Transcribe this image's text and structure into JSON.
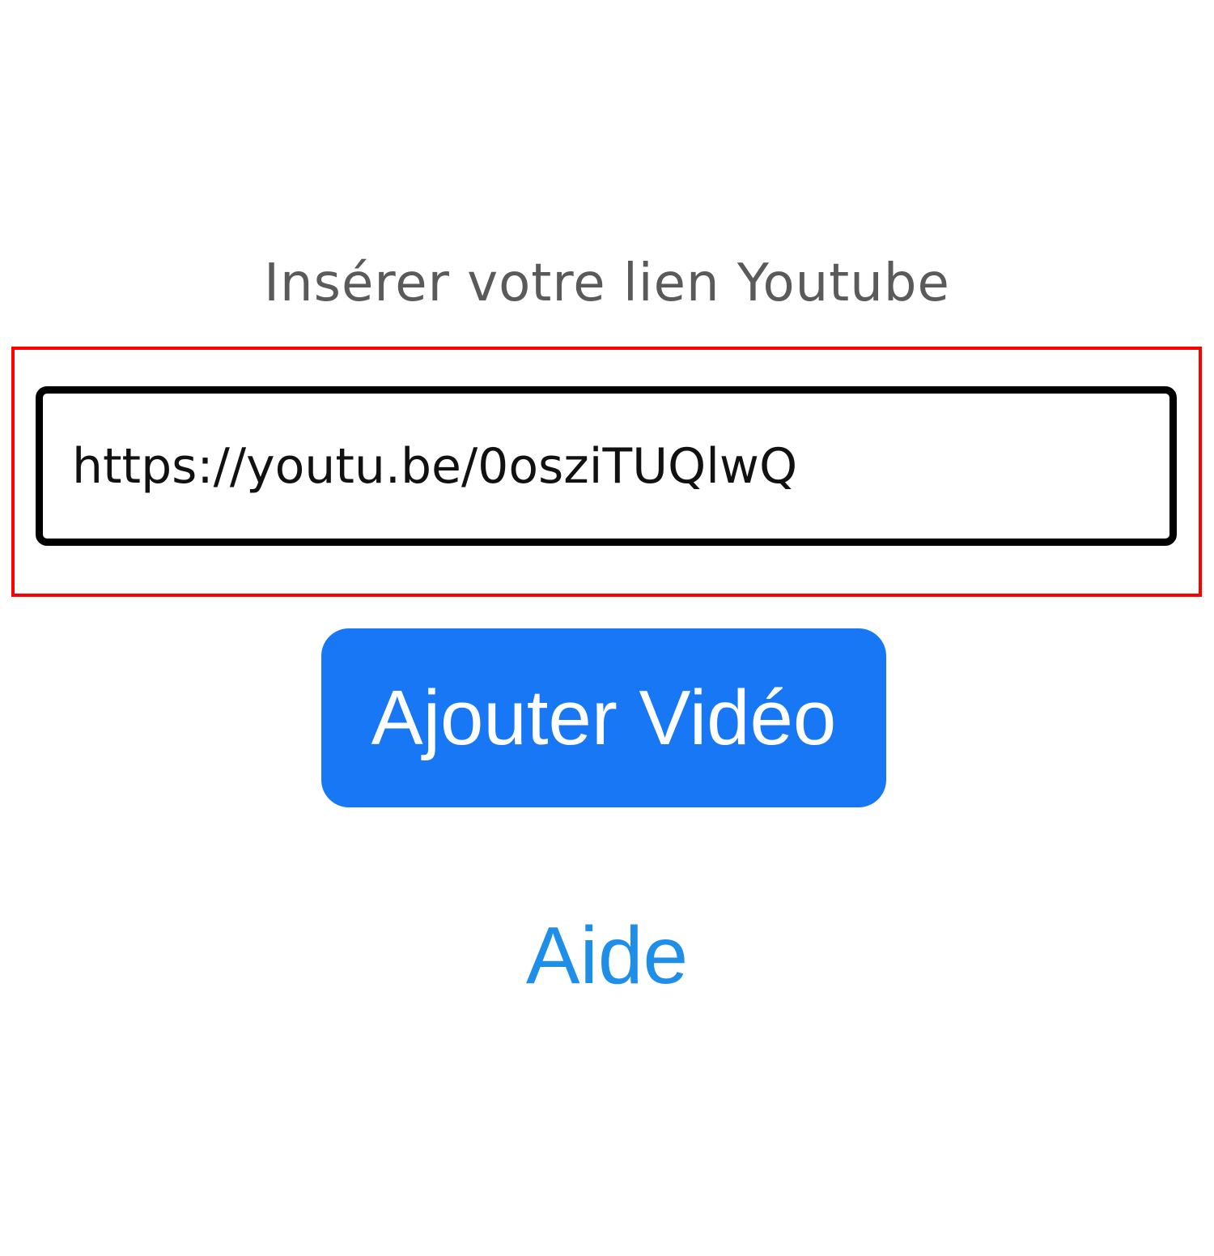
{
  "form": {
    "label": "Insérer votre lien Youtube",
    "url_value": "https://youtu.be/0osziTUQlwQ",
    "submit_label": "Ajouter Vidéo",
    "help_label": "Aide"
  },
  "colors": {
    "button_background": "#1877f5",
    "link": "#1e8ee8",
    "highlight_border": "#ff0000",
    "label_text": "#5a5a5a"
  }
}
